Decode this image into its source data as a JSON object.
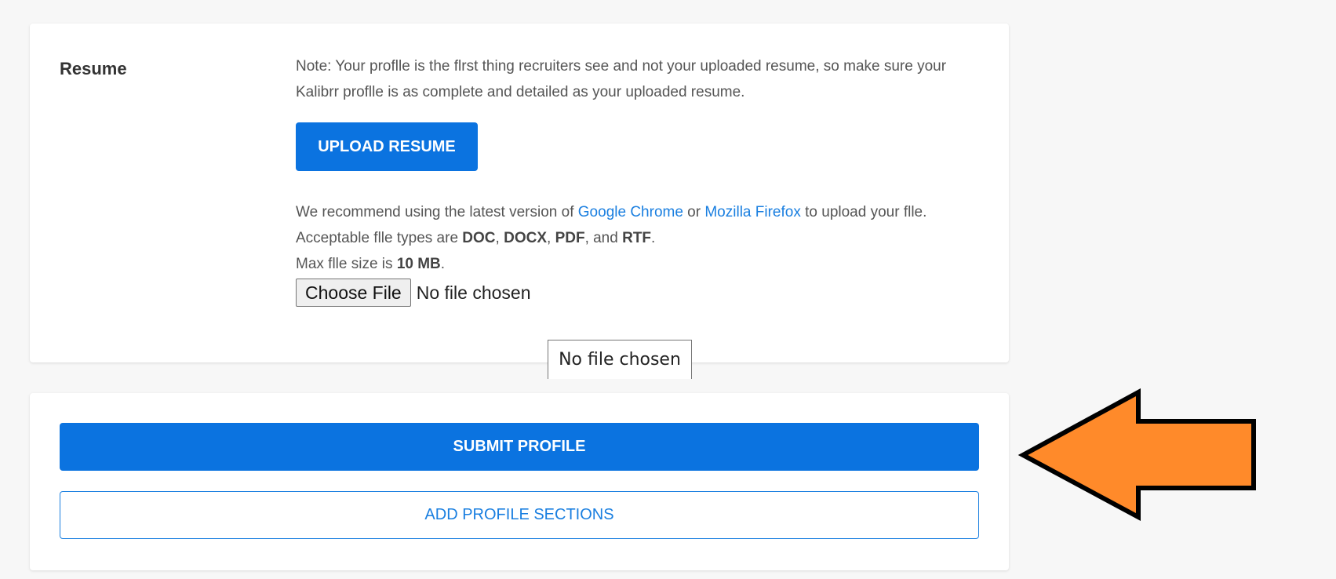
{
  "resume": {
    "label": "Resume",
    "note": "Note: Your proflle is the flrst thing recruiters see and not your uploaded resume, so make sure your Kalibrr proflle is as complete and detailed as your uploaded resume.",
    "upload_button": "UPLOAD RESUME",
    "recommend_prefix": "We recommend using the latest version of ",
    "chrome_link": "Google Chrome",
    "or_text": " or ",
    "firefox_link": "Mozilla Firefox",
    "recommend_suffix": " to upload your flle.",
    "types_prefix": "Acceptable flle types are ",
    "type_doc": "DOC",
    "sep1": ", ",
    "type_docx": "DOCX",
    "sep2": ", ",
    "type_pdf": "PDF",
    "sep3": ", and ",
    "type_rtf": "RTF",
    "types_suffix": ".",
    "size_prefix": "Max flle size is ",
    "size_value": "10 MB",
    "size_suffix": ".",
    "choose_file_button": "Choose File",
    "file_status": "No file chosen",
    "tooltip": "No file chosen"
  },
  "actions": {
    "submit_button": "SUBMIT PROFILE",
    "add_sections_button": "ADD PROFILE SECTIONS"
  },
  "annotation": {
    "arrow_icon": "left-arrow-icon",
    "arrow_color": "#ff8a2a"
  },
  "colors": {
    "primary": "#0b73e0",
    "link": "#1a7fe0"
  }
}
